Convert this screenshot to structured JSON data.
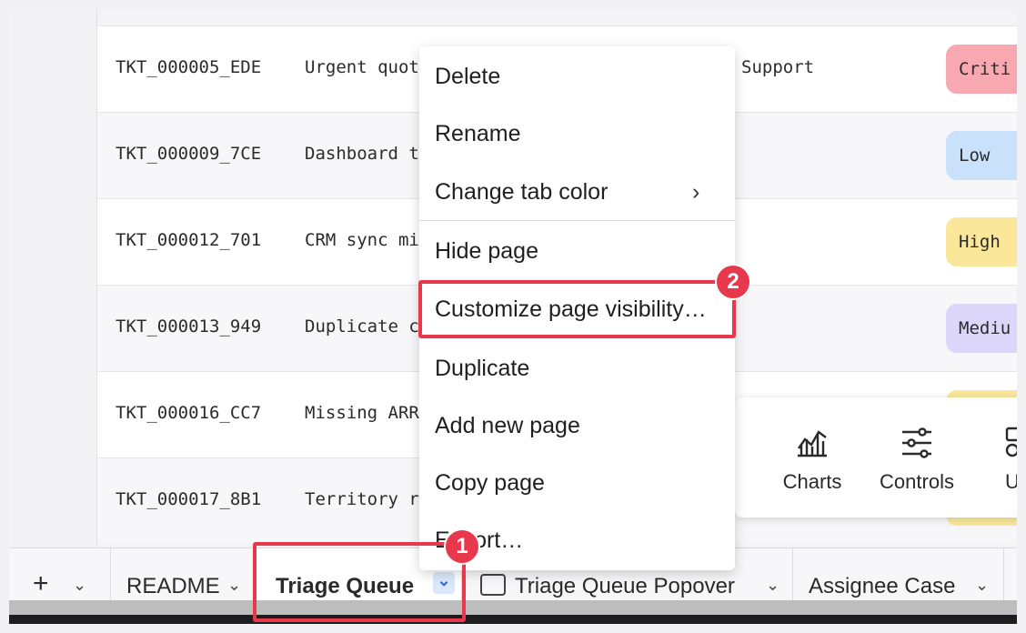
{
  "table": {
    "rows": [
      {
        "id": "TKT_000005_EDE",
        "subject": "Urgent quot",
        "team": "Support",
        "priority": "Criti",
        "color": "#f7a8b0"
      },
      {
        "id": "TKT_000009_7CE",
        "subject": "Dashboard t",
        "team": "",
        "priority": "Low",
        "color": "#c9e1fb"
      },
      {
        "id": "TKT_000012_701",
        "subject": "CRM sync mi",
        "team": "",
        "priority": "High",
        "color": "#fae79a"
      },
      {
        "id": "TKT_000013_949",
        "subject": "Duplicate c",
        "team": "",
        "priority": "Mediu",
        "color": "#ddd6fb"
      },
      {
        "id": "TKT_000016_CC7",
        "subject": "Missing ARR",
        "team": "",
        "priority": "",
        "color": "#fae79a"
      },
      {
        "id": "TKT_000017_8B1",
        "subject": "Territory r",
        "team": "",
        "priority": "",
        "color": "#fae79a"
      }
    ]
  },
  "context_menu": {
    "items": [
      {
        "label": "Delete"
      },
      {
        "label": "Rename"
      },
      {
        "label": "Change tab color",
        "has_submenu": true
      },
      {
        "label": "Hide page"
      },
      {
        "label": "Customize page visibility…"
      },
      {
        "label": "Duplicate"
      },
      {
        "label": "Add new page"
      },
      {
        "label": "Copy page"
      },
      {
        "label": "Export…"
      }
    ]
  },
  "insert_panel": {
    "items": [
      {
        "label": "Charts",
        "icon": "charts-icon"
      },
      {
        "label": "Controls",
        "icon": "controls-icon"
      },
      {
        "label": "U",
        "icon": "ui-elements-icon"
      }
    ]
  },
  "tabs": {
    "add_label": "+",
    "items": [
      {
        "label": "README"
      },
      {
        "label": "Triage Queue",
        "active": true
      },
      {
        "label": "Triage Queue Popover",
        "has_checkbox": true
      },
      {
        "label": "Assignee Case"
      }
    ]
  },
  "annotations": {
    "step1": "1",
    "step2": "2",
    "color": "#e8384c"
  }
}
